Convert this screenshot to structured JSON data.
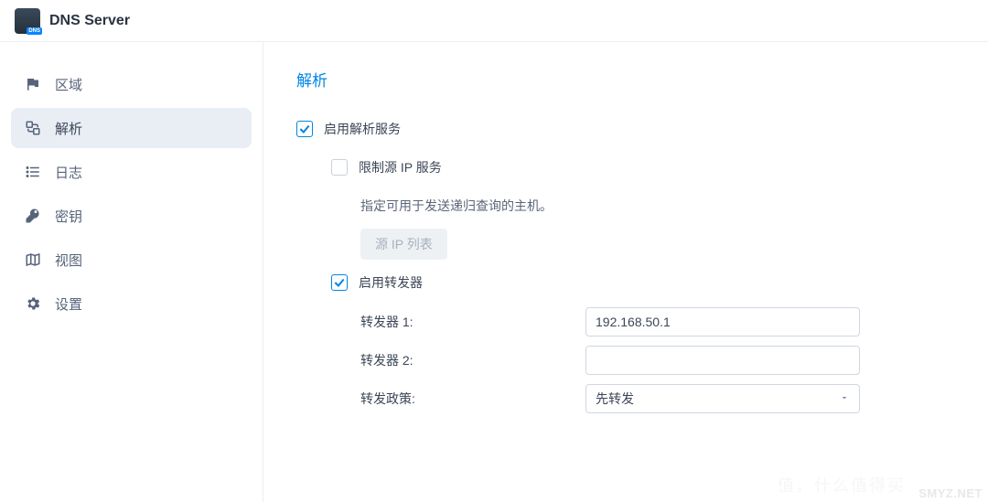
{
  "app": {
    "title": "DNS Server",
    "icon_badge": "DNS"
  },
  "sidebar": {
    "items": [
      {
        "id": "zones",
        "label": "区域",
        "icon": "flag-icon"
      },
      {
        "id": "resolve",
        "label": "解析",
        "icon": "resolve-icon",
        "active": true
      },
      {
        "id": "logs",
        "label": "日志",
        "icon": "list-icon"
      },
      {
        "id": "keys",
        "label": "密钥",
        "icon": "key-icon"
      },
      {
        "id": "views",
        "label": "视图",
        "icon": "map-icon"
      },
      {
        "id": "settings",
        "label": "设置",
        "icon": "gear-icon"
      }
    ]
  },
  "content": {
    "title": "解析",
    "enable_resolve": {
      "label": "启用解析服务",
      "checked": true
    },
    "limit_source_ip": {
      "label": "限制源 IP 服务",
      "checked": false,
      "help": "指定可用于发送递归查询的主机。",
      "button_label": "源 IP 列表"
    },
    "enable_forwarder": {
      "label": "启用转发器",
      "checked": true
    },
    "forwarder1": {
      "label": "转发器 1:",
      "value": "192.168.50.1"
    },
    "forwarder2": {
      "label": "转发器 2:",
      "value": ""
    },
    "forward_policy": {
      "label": "转发政策:",
      "value": "先转发"
    }
  },
  "watermark": "SMYZ.NET",
  "watermark2": "值，什么值得买"
}
